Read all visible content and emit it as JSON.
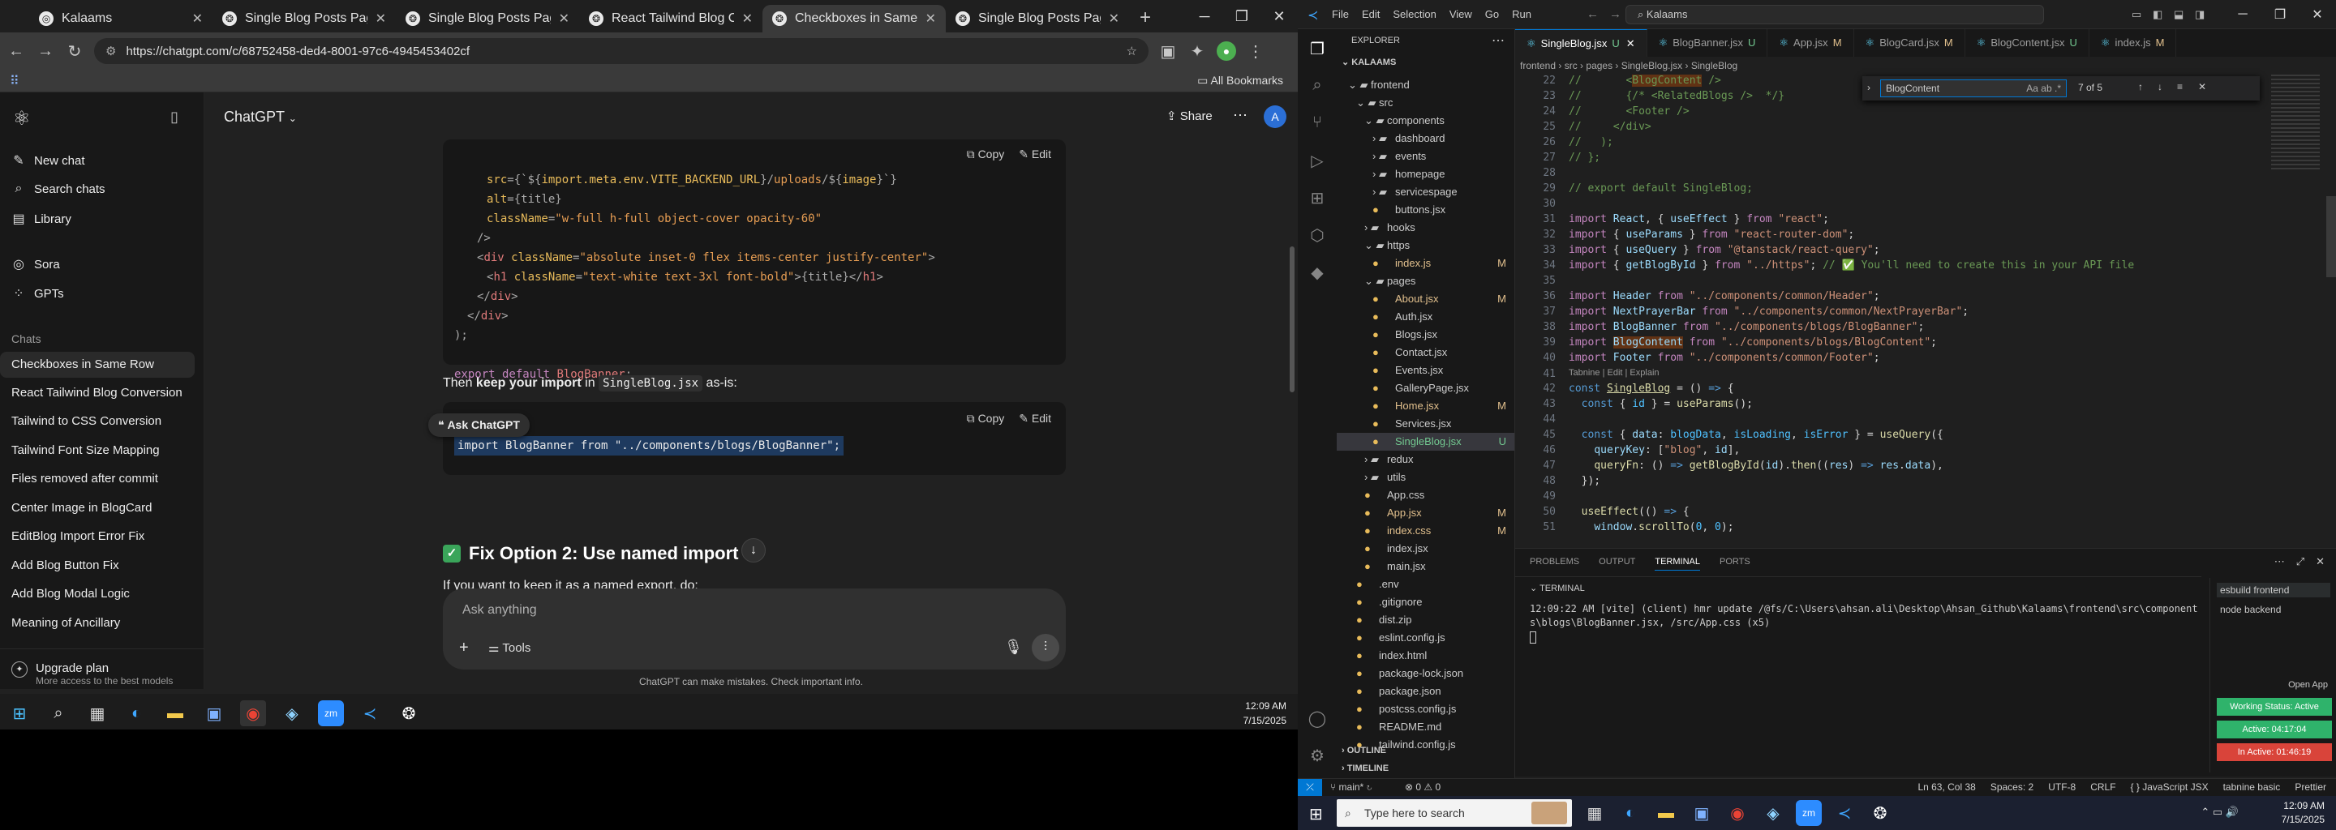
{
  "chrome": {
    "tabs": [
      {
        "title": "Kalaams",
        "active": false
      },
      {
        "title": "Single Blog Posts Page Desig",
        "active": false
      },
      {
        "title": "Single Blog Posts Page Desig",
        "active": false
      },
      {
        "title": "React Tailwind Blog Convers",
        "active": false
      },
      {
        "title": "Checkboxes in Same Row",
        "active": true
      },
      {
        "title": "Single Blog Posts Page Desig",
        "active": false
      }
    ],
    "url": "https://chatgpt.com/c/68752458-ded4-8001-97c6-4945453402cf",
    "all_bookmarks": "All Bookmarks"
  },
  "gpt": {
    "sidebar": {
      "new_chat": "New chat",
      "search_chats": "Search chats",
      "library": "Library",
      "sora": "Sora",
      "gpts": "GPTs",
      "chats_heading": "Chats",
      "chats": [
        "Checkboxes in Same Row",
        "React Tailwind Blog Conversion",
        "Tailwind to CSS Conversion",
        "Tailwind Font Size Mapping",
        "Files removed after commit",
        "Center Image in BlogCard",
        "EditBlog Import Error Fix",
        "Add Blog Button Fix",
        "Add Blog Modal Logic",
        "Meaning of Ancillary"
      ],
      "upgrade_title": "Upgrade plan",
      "upgrade_sub": "More access to the best models"
    },
    "header": {
      "model": "ChatGPT",
      "share": "Share",
      "avatar": "A"
    },
    "code1": {
      "copy": "Copy",
      "edit": "Edit",
      "lines": [
        "src={`${import.meta.env.VITE_BACKEND_URL}/uploads/${image}`}",
        "alt={title}",
        "className=\"w-full h-full object-cover opacity-60\"",
        "/>",
        "<div className=\"absolute inset-0 flex items-center justify-center\">",
        "<h1 className=\"text-white text-3xl font-bold\">{title}</h1>",
        "</div>",
        "</div>",
        ");"
      ],
      "export_line": "export default BlogBanner;"
    },
    "para1_pre": "Then ",
    "para1_bold": "keep your import",
    "para1_mid": " in ",
    "para1_code": "SingleBlog.jsx",
    "para1_post": " as-is:",
    "ask_chatgpt": "Ask ChatGPT",
    "code2": {
      "copy": "Copy",
      "edit": "Edit",
      "line": "import BlogBanner from \"../components/blogs/BlogBanner\";"
    },
    "fix2_heading": "Fix Option 2: Use named import",
    "fix2_partial": "If you want to keep it as a named export, do:",
    "composer": {
      "placeholder": "Ask anything",
      "tools": "Tools"
    },
    "disclaimer": "ChatGPT can make mistakes. Check important info."
  },
  "taskbar_left": {
    "time": "12:09 AM",
    "date": "7/15/2025"
  },
  "vscode": {
    "menu": [
      "File",
      "Edit",
      "Selection",
      "View",
      "Go",
      "Run"
    ],
    "search": "Kalaams",
    "explorer_title": "EXPLORER",
    "root": "KALAAMS",
    "tree": [
      {
        "label": "frontend",
        "depth": 1,
        "type": "folder-open"
      },
      {
        "label": "src",
        "depth": 2,
        "type": "folder-open"
      },
      {
        "label": "components",
        "depth": 3,
        "type": "folder-open"
      },
      {
        "label": "dashboard",
        "depth": 4,
        "type": "folder"
      },
      {
        "label": "events",
        "depth": 4,
        "type": "folder"
      },
      {
        "label": "homepage",
        "depth": 4,
        "type": "folder"
      },
      {
        "label": "servicespage",
        "depth": 4,
        "type": "folder"
      },
      {
        "label": "buttons.jsx",
        "depth": 4,
        "type": "file"
      },
      {
        "label": "hooks",
        "depth": 3,
        "type": "folder"
      },
      {
        "label": "https",
        "depth": 3,
        "type": "folder-open"
      },
      {
        "label": "index.js",
        "depth": 4,
        "type": "file",
        "badge": "M"
      },
      {
        "label": "pages",
        "depth": 3,
        "type": "folder-open"
      },
      {
        "label": "About.jsx",
        "depth": 4,
        "type": "file",
        "badge": "M"
      },
      {
        "label": "Auth.jsx",
        "depth": 4,
        "type": "file"
      },
      {
        "label": "Blogs.jsx",
        "depth": 4,
        "type": "file"
      },
      {
        "label": "Contact.jsx",
        "depth": 4,
        "type": "file"
      },
      {
        "label": "Events.jsx",
        "depth": 4,
        "type": "file"
      },
      {
        "label": "GalleryPage.jsx",
        "depth": 4,
        "type": "file"
      },
      {
        "label": "Home.jsx",
        "depth": 4,
        "type": "file",
        "badge": "M"
      },
      {
        "label": "Services.jsx",
        "depth": 4,
        "type": "file"
      },
      {
        "label": "SingleBlog.jsx",
        "depth": 4,
        "type": "file",
        "badge": "U",
        "selected": true
      },
      {
        "label": "redux",
        "depth": 3,
        "type": "folder"
      },
      {
        "label": "utils",
        "depth": 3,
        "type": "folder"
      },
      {
        "label": "App.css",
        "depth": 3,
        "type": "file"
      },
      {
        "label": "App.jsx",
        "depth": 3,
        "type": "file",
        "badge": "M"
      },
      {
        "label": "index.css",
        "depth": 3,
        "type": "file",
        "badge": "M"
      },
      {
        "label": "index.jsx",
        "depth": 3,
        "type": "file"
      },
      {
        "label": "main.jsx",
        "depth": 3,
        "type": "file"
      },
      {
        "label": ".env",
        "depth": 2,
        "type": "file"
      },
      {
        "label": ".gitignore",
        "depth": 2,
        "type": "file"
      },
      {
        "label": "dist.zip",
        "depth": 2,
        "type": "file"
      },
      {
        "label": "eslint.config.js",
        "depth": 2,
        "type": "file"
      },
      {
        "label": "index.html",
        "depth": 2,
        "type": "file"
      },
      {
        "label": "package-lock.json",
        "depth": 2,
        "type": "file"
      },
      {
        "label": "package.json",
        "depth": 2,
        "type": "file"
      },
      {
        "label": "postcss.config.js",
        "depth": 2,
        "type": "file"
      },
      {
        "label": "README.md",
        "depth": 2,
        "type": "file"
      },
      {
        "label": "tailwind.config.js",
        "depth": 2,
        "type": "file"
      }
    ],
    "outline": "OUTLINE",
    "timeline": "TIMELINE",
    "tabs": [
      {
        "label": "SingleBlog.jsx",
        "badge": "U",
        "active": true
      },
      {
        "label": "BlogBanner.jsx",
        "badge": "U"
      },
      {
        "label": "App.jsx",
        "badge": "M"
      },
      {
        "label": "BlogCard.jsx",
        "badge": "M"
      },
      {
        "label": "BlogContent.jsx",
        "badge": "U"
      },
      {
        "label": "index.js",
        "badge": "M"
      }
    ],
    "breadcrumb": [
      "frontend",
      "src",
      "pages",
      "SingleBlog.jsx",
      "SingleBlog"
    ],
    "find": {
      "query": "BlogContent",
      "count": "7 of 5"
    },
    "codelens": "Tabnine | Edit | Explain",
    "line_numbers": [
      "22",
      "23",
      "24",
      "25",
      "26",
      "27",
      "28",
      "29",
      "30",
      "31",
      "32",
      "33",
      "34",
      "35",
      "36",
      "37",
      "38",
      "39",
      "40",
      "41",
      "42",
      "43",
      "44",
      "45",
      "46",
      "47",
      "48",
      "49",
      "50",
      "51"
    ],
    "panel_tabs": [
      "PROBLEMS",
      "OUTPUT",
      "TERMINAL",
      "PORTS"
    ],
    "terminal_label": "TERMINAL",
    "terminal_line": "12:09:22 AM [vite] (client) hmr update /@fs/C:\\Users\\ahsan.ali\\Desktop\\Ahsan_Github\\Kalaams\\frontend\\src\\components\\blogs\\BlogBanner.jsx, /src/App.css (x5)",
    "terminals": [
      "esbuild  frontend",
      "node  backend"
    ],
    "open_app": "Open App",
    "working_status": "Working Status: Active",
    "active_time": "Active: 04:17:04",
    "inactive_time": "In Active: 01:46:19",
    "status_left": [
      "main*",
      "⊗ 0 ⚠ 0"
    ],
    "status_right": [
      "Ln 63, Col 38",
      "Spaces: 2",
      "UTF-8",
      "CRLF",
      "{ } JavaScript JSX",
      "tabnine basic",
      "Prettier"
    ]
  },
  "taskbar_right": {
    "search": "Type here to search",
    "time": "12:09 AM",
    "date": "7/15/2025"
  }
}
